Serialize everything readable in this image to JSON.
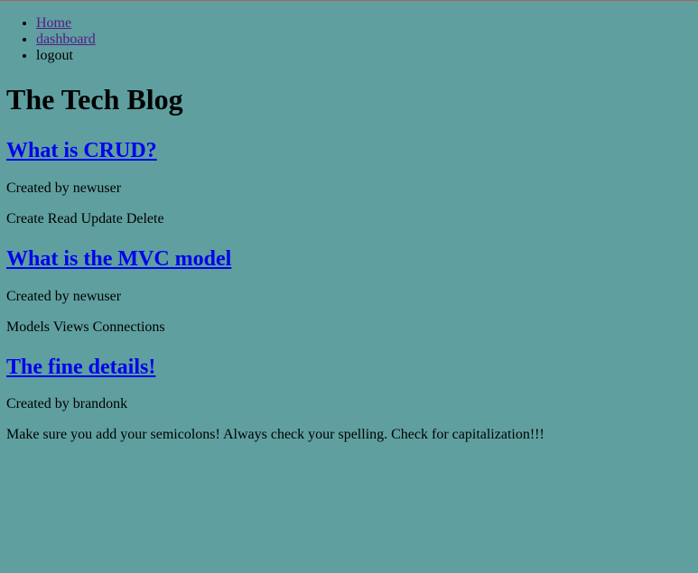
{
  "nav": {
    "items": [
      {
        "label": "Home",
        "link": true
      },
      {
        "label": "dashboard",
        "link": true
      },
      {
        "label": "logout",
        "link": false
      }
    ]
  },
  "site": {
    "title": "The Tech Blog"
  },
  "posts": [
    {
      "title": "What is CRUD?",
      "author_line": "Created by newuser",
      "body": "Create Read Update Delete"
    },
    {
      "title": "What is the MVC model",
      "author_line": "Created by newuser",
      "body": "Models Views Connections"
    },
    {
      "title": "The fine details!",
      "author_line": "Created by brandonk",
      "body": "Make sure you add your semicolons! Always check your spelling. Check for capitalization!!!"
    }
  ],
  "colors": {
    "background": "#5f9f9f",
    "visited_link": "#551a8b",
    "link": "#0000ee"
  }
}
